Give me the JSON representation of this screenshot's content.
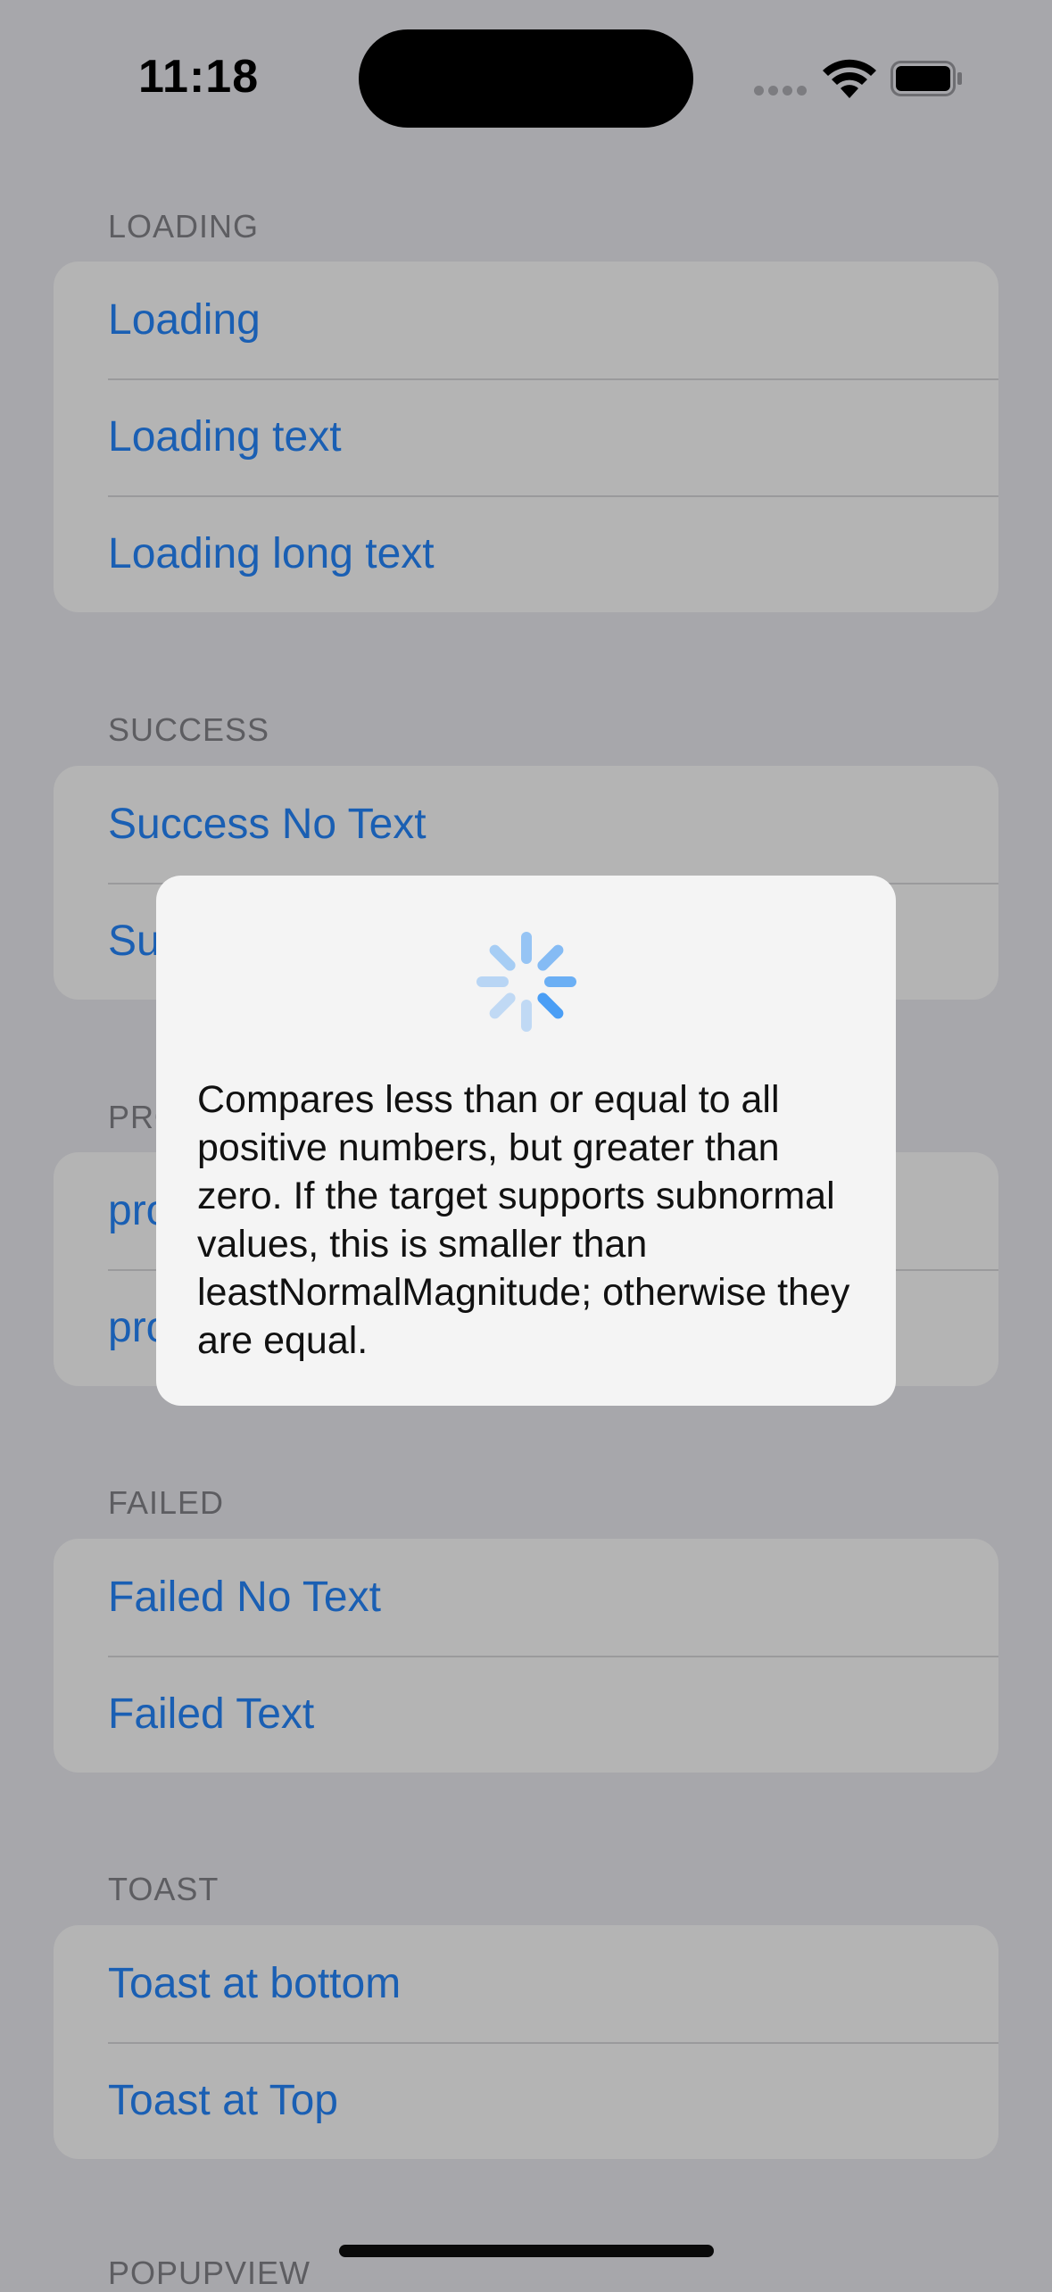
{
  "status_bar": {
    "time": "11:18"
  },
  "sections": [
    {
      "header": "LOADING",
      "items": [
        "Loading",
        "Loading text",
        "Loading long text"
      ]
    },
    {
      "header": "SUCCESS",
      "items": [
        "Success No Text",
        "Su"
      ]
    },
    {
      "header": "PRO",
      "items": [
        "pro",
        "pro"
      ]
    },
    {
      "header": "FAILED",
      "items": [
        "Failed No Text",
        "Failed Text"
      ]
    },
    {
      "header": "TOAST",
      "items": [
        "Toast at bottom",
        "Toast at Top"
      ]
    },
    {
      "header": "POPUPVIEW",
      "items": []
    }
  ],
  "hud": {
    "icon": "loading-spinner-icon",
    "message": "Compares less than or equal to all positive numbers, but greater than zero. If the target supports subnormal values, this is smaller than leastNormalMagnitude; otherwise they are equal."
  },
  "colors": {
    "accent": "#1a5fb3",
    "dim_background": "#a7a7ab",
    "hud_background": "#f4f4f4",
    "spinner": "#4a9ef5"
  }
}
